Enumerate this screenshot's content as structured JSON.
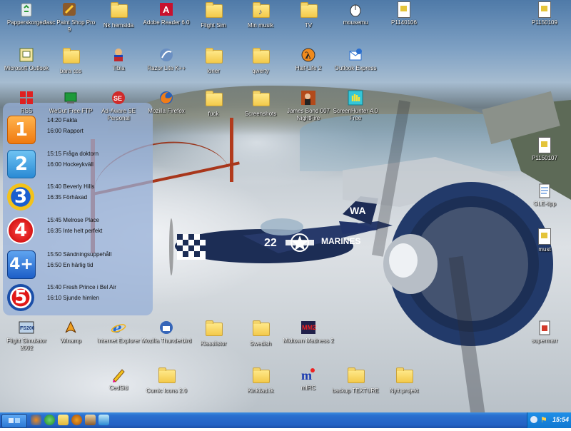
{
  "desktop": {
    "icons": [
      {
        "label": "Papperskorgen",
        "icon": "recycle-bin-icon"
      },
      {
        "label": "Jasc Paint Shop Pro 9",
        "icon": "paint-shop-icon"
      },
      {
        "label": "Nk hemsida",
        "icon": "folder-icon"
      },
      {
        "label": "Adobe Reader 6.0",
        "icon": "adobe-reader-icon"
      },
      {
        "label": "Flight Sim",
        "icon": "folder-icon"
      },
      {
        "label": "Min musik",
        "icon": "music-folder-icon"
      },
      {
        "label": "TV",
        "icon": "folder-icon"
      },
      {
        "label": "mousemu",
        "icon": "mouse-icon"
      },
      {
        "label": "P1140106",
        "icon": "image-file-icon"
      },
      {
        "label": "P1150109",
        "icon": "image-file-icon"
      },
      {
        "label": "Microsoft Outlook",
        "icon": "outlook-icon"
      },
      {
        "label": "bara css",
        "icon": "folder-icon"
      },
      {
        "label": "Tibia",
        "icon": "tibia-icon"
      },
      {
        "label": "Razor Lite K++",
        "icon": "razor-icon"
      },
      {
        "label": "loner",
        "icon": "folder-icon"
      },
      {
        "label": "qwerty",
        "icon": "folder-icon"
      },
      {
        "label": "Half-Life 2",
        "icon": "half-life-icon"
      },
      {
        "label": "Outlook Express",
        "icon": "outlook-express-icon"
      },
      {
        "label": "RSS",
        "icon": "rss-icon"
      },
      {
        "label": "WeOut Free FTP",
        "icon": "ftp-icon"
      },
      {
        "label": "Ad-Aware SE Personal",
        "icon": "ad-aware-icon"
      },
      {
        "label": "Mozilla Firefox",
        "icon": "firefox-icon"
      },
      {
        "label": "fuck",
        "icon": "folder-icon"
      },
      {
        "label": "Screenshots",
        "icon": "folder-icon"
      },
      {
        "label": "James Bond 007 NightFire",
        "icon": "james-bond-icon"
      },
      {
        "label": "ScreenHunter 4.0 Free",
        "icon": "screenhunter-icon"
      },
      {
        "label": "P1150107",
        "icon": "image-file-icon"
      },
      {
        "label": "OLE-tipp",
        "icon": "document-icon"
      },
      {
        "label": "must",
        "icon": "image-file-icon"
      },
      {
        "label": "Flight Simulator 2002",
        "icon": "flight-simulator-icon"
      },
      {
        "label": "Winamp",
        "icon": "winamp-icon"
      },
      {
        "label": "Internet Explorer",
        "icon": "internet-explorer-icon"
      },
      {
        "label": "Mozilla Thunderbird",
        "icon": "thunderbird-icon"
      },
      {
        "label": "Klasslistor",
        "icon": "folder-icon"
      },
      {
        "label": "Swedish",
        "icon": "folder-icon"
      },
      {
        "label": "Midtown Madness 2",
        "icon": "midtown-madness-icon"
      },
      {
        "label": "supermarr",
        "icon": "image-file-icon"
      },
      {
        "label": "CedSid",
        "icon": "pencil-icon"
      },
      {
        "label": "Comic Icons 2.0",
        "icon": "folder-icon"
      },
      {
        "label": "Kinkilad.tk",
        "icon": "folder-icon"
      },
      {
        "label": "mIRC",
        "icon": "mirc-icon"
      },
      {
        "label": "backup TEXTURE",
        "icon": "folder-icon"
      },
      {
        "label": "Nytt projekt",
        "icon": "folder-icon"
      }
    ]
  },
  "tv_guide": {
    "channels": [
      {
        "logo": "1",
        "lines": [
          "14:20 Fakta",
          "16:00 Rapport"
        ]
      },
      {
        "logo": "2",
        "lines": [
          "15:15 Fråga doktorn",
          "16:00 Hockeykväll"
        ]
      },
      {
        "logo": "3",
        "lines": [
          "15:40 Beverly Hills",
          "16:35 Förhäxad"
        ]
      },
      {
        "logo": "4",
        "lines": [
          "15:45 Melrose Place",
          "16:35 Inte helt perfekt"
        ]
      },
      {
        "logo": "4+",
        "lines": [
          "15:50 Sändningsuppehåll",
          "16:50 En härlig tid"
        ]
      },
      {
        "logo": "5",
        "lines": [
          "15:40 Fresh Prince i Bel Air",
          "16:10 Sjunde himlen"
        ]
      }
    ]
  },
  "airplane": {
    "tail_code": "WA",
    "fuselage_number": "22",
    "fuselage_text": "MARINES"
  },
  "taskbar": {
    "quick_launch": [
      "firefox-icon",
      "internet-explorer-icon",
      "explorer-icon",
      "half-life-icon",
      "paint-icon",
      "tibia-icon"
    ],
    "clock": "15:54",
    "colors": {
      "taskbar": "#2461c3",
      "tray": "#1077d0"
    }
  }
}
